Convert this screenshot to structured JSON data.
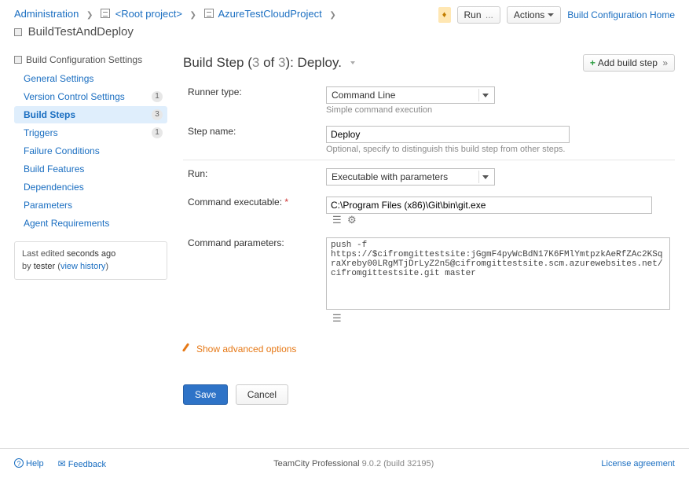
{
  "breadcrumbs": {
    "admin": "Administration",
    "root": "<Root project>",
    "project": "AzureTestCloudProject",
    "config": "BuildTestAndDeploy"
  },
  "top_actions": {
    "run": "Run",
    "run_suffix": "...",
    "actions": "Actions",
    "home_link": "Build Configuration Home"
  },
  "sidebar": {
    "heading": "Build Configuration Settings",
    "items": [
      {
        "label": "General Settings",
        "badge": ""
      },
      {
        "label": "Version Control Settings",
        "badge": "1"
      },
      {
        "label": "Build Steps",
        "badge": "3"
      },
      {
        "label": "Triggers",
        "badge": "1"
      },
      {
        "label": "Failure Conditions",
        "badge": ""
      },
      {
        "label": "Build Features",
        "badge": ""
      },
      {
        "label": "Dependencies",
        "badge": ""
      },
      {
        "label": "Parameters",
        "badge": ""
      },
      {
        "label": "Agent Requirements",
        "badge": ""
      }
    ],
    "edit_box": {
      "line1a": "Last edited",
      "line1b": "seconds ago",
      "line2a": "by",
      "line2b": "tester",
      "history": "view history"
    }
  },
  "content": {
    "title_prefix": "Build Step (",
    "step_cur": "3",
    "step_of": " of ",
    "step_total": "3",
    "title_suffix": "): Deploy.",
    "add_btn": "Add build step",
    "fields": {
      "runner_label": "Runner type:",
      "runner_value": "Command Line",
      "runner_hint": "Simple command execution",
      "step_name_label": "Step name:",
      "step_name_value": "Deploy",
      "step_name_hint": "Optional, specify to distinguish this build step from other steps.",
      "run_label": "Run:",
      "run_value": "Executable with parameters",
      "exec_label": "Command executable:",
      "exec_value": "C:\\Program Files (x86)\\Git\\bin\\git.exe",
      "params_label": "Command parameters:",
      "params_value": "push -f https://$cifromgittestsite:jGgmF4pyWcBdN17K6FMlYmtpzkAeRfZAc2KSqraXreby00LRgMTjDrLyZ2n5@cifromgittestsite.scm.azurewebsites.net/cifromgittestsite.git master"
    },
    "advanced": "Show advanced options",
    "save": "Save",
    "cancel": "Cancel"
  },
  "footer": {
    "help": "Help",
    "feedback": "Feedback",
    "product": "TeamCity Professional",
    "version": "9.0.2 (build 32195)",
    "license": "License agreement"
  }
}
